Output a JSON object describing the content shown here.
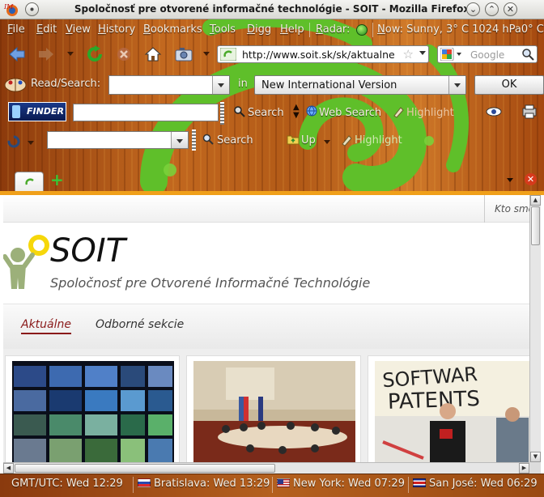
{
  "window": {
    "title": "Spoločnosť pre otvorené informačné technológie - SOIT - Mozilla Firefox",
    "logo_text": "IM",
    "minimize_glyph": "⌄",
    "maximize_glyph": "⌃",
    "close_glyph": "✕"
  },
  "menu": {
    "items": [
      "File",
      "Edit",
      "View",
      "History",
      "Bookmarks",
      "Tools",
      "Digg",
      "Help"
    ],
    "radar_label": "Radar:",
    "weather": "Now: Sunny, 3° C 1024 hPa0° C"
  },
  "navigation": {
    "url": "http://www.soit.sk/sk/aktualne",
    "search_placeholder": "Google"
  },
  "bible_toolbar": {
    "read_search_label": "Read/Search:",
    "in_label": "in",
    "version": "New International Version",
    "ok_label": "OK"
  },
  "finder_toolbar": {
    "logo_text": "FINDER",
    "search_label": "Search",
    "web_search_label": "Web Search",
    "highlight_label": "Highlight"
  },
  "third_toolbar": {
    "search_label": "Search",
    "up_label": "Up",
    "highlight_label": "Highlight"
  },
  "page": {
    "top_right_text": "Kto sme",
    "brand": "SOIT",
    "tagline": "Spoločnosť pre Otvorené Informačné Technológie",
    "nav": {
      "active": "Aktuálne",
      "other": "Odborné sekcie"
    },
    "thumb3_text_1": "SOFTWAR",
    "thumb3_text_2": "PATENTS"
  },
  "statusbar": {
    "clocks": [
      {
        "label": "GMT/UTC: Wed 12:29"
      },
      {
        "label": "Bratislava: Wed 13:29"
      },
      {
        "label": "New York: Wed 07:29"
      },
      {
        "label": "San José: Wed 06:29"
      }
    ]
  },
  "colors": {
    "chrome_wood": "#b25a17",
    "swirl_green": "#5fbf2a",
    "accent_orange": "#f0a01a",
    "nav_active": "#8a1a1a"
  }
}
